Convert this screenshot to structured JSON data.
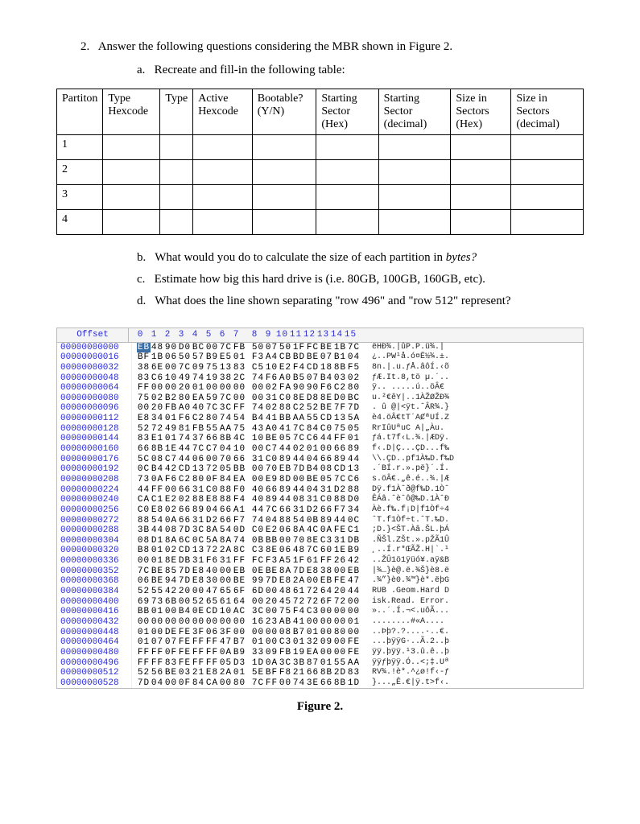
{
  "question_number": "2.",
  "question_text": "Answer the following questions considering the MBR shown in Figure 2.",
  "sub_a_label": "a.",
  "sub_a_text": "Recreate and fill-in the following table:",
  "sub_b_label": "b.",
  "sub_b_text_1": "What would you do to calculate the size of each partition in ",
  "sub_b_text_em": "bytes?",
  "sub_c_label": "c.",
  "sub_c_text": "Estimate how big this hard drive is (i.e. 80GB, 100GB, 160GB, etc).",
  "sub_d_label": "d.",
  "sub_d_text": "What does the line shown separating \"row 496\" and \"row 512\" represent?",
  "table": {
    "headers": [
      "Partiton",
      "Type Hexcode",
      "Type",
      "Active Hexcode",
      "Bootable? (Y/N)",
      "Starting Sector (Hex)",
      "Starting Sector (decimal)",
      "Size in Sectors (Hex)",
      "Size in Sectors (decimal)"
    ],
    "rows": [
      "1",
      "2",
      "3",
      "4"
    ]
  },
  "hex": {
    "offset_label": "Offset",
    "col_nums": [
      "0",
      "1",
      "2",
      "3",
      "4",
      "5",
      "6",
      "7",
      "8",
      "9",
      "10",
      "11",
      "12",
      "13",
      "14",
      "15"
    ],
    "rows": [
      {
        "off": "00000000000",
        "hl0": true,
        "b": [
          "EB",
          "48",
          "90",
          "D0",
          "BC",
          "00",
          "7C",
          "FB",
          "50",
          "07",
          "50",
          "1F",
          "FC",
          "BE",
          "1B",
          "7C"
        ],
        "a": "ëHĐ¾.|ûP.P.ü¾.|"
      },
      {
        "off": "00000000016",
        "b": [
          "BF",
          "1B",
          "06",
          "50",
          "57",
          "B9",
          "E5",
          "01",
          "F3",
          "A4",
          "CB",
          "BD",
          "BE",
          "07",
          "B1",
          "04"
        ],
        "a": "¿..PW¹å.ó¤Ë½¾.±."
      },
      {
        "off": "00000000032",
        "b": [
          "38",
          "6E",
          "00",
          "7C",
          "09",
          "75",
          "13",
          "83",
          "C5",
          "10",
          "E2",
          "F4",
          "CD",
          "18",
          "8B",
          "F5"
        ],
        "a": "8n.|.u.ƒÅ.âôÍ.‹õ"
      },
      {
        "off": "00000000048",
        "b": [
          "83",
          "C6",
          "10",
          "49",
          "74",
          "19",
          "38",
          "2C",
          "74",
          "F6",
          "A0",
          "B5",
          "07",
          "B4",
          "03",
          "02"
        ],
        "a": "ƒÆ.It.8,tö µ.´.."
      },
      {
        "off": "00000000064",
        "b": [
          "FF",
          "00",
          "00",
          "20",
          "01",
          "00",
          "00",
          "00",
          "00",
          "02",
          "FA",
          "90",
          "90",
          "F6",
          "C2",
          "80"
        ],
        "a": "ÿ.. .....ú..öÂ€"
      },
      {
        "off": "00000000080",
        "b": [
          "75",
          "02",
          "B2",
          "80",
          "EA",
          "59",
          "7C",
          "00",
          "00",
          "31",
          "C0",
          "8E",
          "D8",
          "8E",
          "D0",
          "BC"
        ],
        "a": "u.²€êY|..1ÀŽØŽÐ¾"
      },
      {
        "off": "00000000096",
        "b": [
          "00",
          "20",
          "FB",
          "A0",
          "40",
          "7C",
          "3C",
          "FF",
          "74",
          "02",
          "88",
          "C2",
          "52",
          "BE",
          "7F",
          "7D"
        ],
        "a": ". û @|<ÿt.ˆÂR¾.}"
      },
      {
        "off": "00000000112",
        "b": [
          "E8",
          "34",
          "01",
          "F6",
          "C2",
          "80",
          "74",
          "54",
          "B4",
          "41",
          "BB",
          "AA",
          "55",
          "CD",
          "13",
          "5A"
        ],
        "a": "è4.öÂ€tT´AȻªUÍ.Z"
      },
      {
        "off": "00000000128",
        "b": [
          "52",
          "72",
          "49",
          "81",
          "FB",
          "55",
          "AA",
          "75",
          "43",
          "A0",
          "41",
          "7C",
          "84",
          "C0",
          "75",
          "05"
        ],
        "a": "RrIûUªuC A|„Àu."
      },
      {
        "off": "00000000144",
        "b": [
          "83",
          "E1",
          "01",
          "74",
          "37",
          "66",
          "8B",
          "4C",
          "10",
          "BE",
          "05",
          "7C",
          "C6",
          "44",
          "FF",
          "01"
        ],
        "a": "ƒá.t7f‹L.¾.|ÆDÿ."
      },
      {
        "off": "00000000160",
        "b": [
          "66",
          "8B",
          "1E",
          "44",
          "7C",
          "C7",
          "04",
          "10",
          "00",
          "C7",
          "44",
          "02",
          "01",
          "00",
          "66",
          "89"
        ],
        "a": "f‹.D|Ç...ÇD...f‰"
      },
      {
        "off": "00000000176",
        "b": [
          "5C",
          "08",
          "C7",
          "44",
          "06",
          "00",
          "70",
          "66",
          "31",
          "C0",
          "89",
          "44",
          "04",
          "66",
          "89",
          "44"
        ],
        "a": "\\\\.ÇD..pf1À‰D.f‰D"
      },
      {
        "off": "00000000192",
        "b": [
          "0C",
          "B4",
          "42",
          "CD",
          "13",
          "72",
          "05",
          "BB",
          "00",
          "70",
          "EB",
          "7D",
          "B4",
          "08",
          "CD",
          "13"
        ],
        "a": ".´BÍ.r.».pë}´.Í."
      },
      {
        "off": "00000000208",
        "b": [
          "73",
          "0A",
          "F6",
          "C2",
          "80",
          "0F",
          "84",
          "EA",
          "00",
          "E9",
          "8D",
          "00",
          "BE",
          "05",
          "7C",
          "C6"
        ],
        "a": "s.öÂ€.„ê.é..¾.|Æ"
      },
      {
        "off": "00000000224",
        "b": [
          "44",
          "FF",
          "00",
          "66",
          "31",
          "C0",
          "88",
          "F0",
          "40",
          "66",
          "89",
          "44",
          "04",
          "31",
          "D2",
          "88"
        ],
        "a": "Dÿ.f1Àˆð@f‰D.1Òˆ"
      },
      {
        "off": "00000000240",
        "b": [
          "CA",
          "C1",
          "E2",
          "02",
          "88",
          "E8",
          "88",
          "F4",
          "40",
          "89",
          "44",
          "08",
          "31",
          "C0",
          "88",
          "D0"
        ],
        "a": "ÊÁâ.ˆèˆô@‰D.1ÀˆÐ"
      },
      {
        "off": "00000000256",
        "b": [
          "C0",
          "E8",
          "02",
          "66",
          "89",
          "04",
          "66",
          "A1",
          "44",
          "7C",
          "66",
          "31",
          "D2",
          "66",
          "F7",
          "34"
        ],
        "a": "Àè.f‰.f¡D|f1Òf÷4"
      },
      {
        "off": "00000000272",
        "b": [
          "88",
          "54",
          "0A",
          "66",
          "31",
          "D2",
          "66",
          "F7",
          "74",
          "04",
          "88",
          "54",
          "0B",
          "89",
          "44",
          "0C"
        ],
        "a": "ˆT.f1Òf÷t.ˆT.‰D."
      },
      {
        "off": "00000000288",
        "b": [
          "3B",
          "44",
          "08",
          "7D",
          "3C",
          "8A",
          "54",
          "0D",
          "C0",
          "E2",
          "06",
          "8A",
          "4C",
          "0A",
          "FE",
          "C1"
        ],
        "a": ";D.}<ŠT.Àâ.ŠL.þÁ"
      },
      {
        "off": "00000000304",
        "b": [
          "08",
          "D1",
          "8A",
          "6C",
          "0C",
          "5A",
          "8A",
          "74",
          "0B",
          "BB",
          "00",
          "70",
          "8E",
          "C3",
          "31",
          "DB"
        ],
        "a": ".ÑŠl.ZŠt.».pŽÃ1Û"
      },
      {
        "off": "00000000320",
        "b": [
          "B8",
          "01",
          "02",
          "CD",
          "13",
          "72",
          "2A",
          "8C",
          "C3",
          "8E",
          "06",
          "48",
          "7C",
          "60",
          "1E",
          "B9"
        ],
        "a": "¸..Í.r*ŒÃŽ.H|`.¹"
      },
      {
        "off": "00000000336",
        "b": [
          "00",
          "01",
          "8E",
          "DB",
          "31",
          "F6",
          "31",
          "FF",
          "FC",
          "F3",
          "A5",
          "1F",
          "61",
          "FF",
          "26",
          "42"
        ],
        "a": "..ŽÛ1ö1ÿüó¥.aÿ&B"
      },
      {
        "off": "00000000352",
        "b": [
          "7C",
          "BE",
          "85",
          "7D",
          "E8",
          "40",
          "00",
          "EB",
          "0E",
          "BE",
          "8A",
          "7D",
          "E8",
          "38",
          "00",
          "EB"
        ],
        "a": "|¾…}è@.ë.¾Š}è8.ë"
      },
      {
        "off": "00000000368",
        "b": [
          "06",
          "BE",
          "94",
          "7D",
          "E8",
          "30",
          "00",
          "BE",
          "99",
          "7D",
          "E8",
          "2A",
          "00",
          "EB",
          "FE",
          "47"
        ],
        "a": ".¾”}è0.¾™}è*.ëþG"
      },
      {
        "off": "00000000384",
        "b": [
          "52",
          "55",
          "42",
          "20",
          "00",
          "47",
          "65",
          "6F",
          "6D",
          "00",
          "48",
          "61",
          "72",
          "64",
          "20",
          "44"
        ],
        "a": "RUB .Geom.Hard D"
      },
      {
        "off": "00000000400",
        "b": [
          "69",
          "73",
          "6B",
          "00",
          "52",
          "65",
          "61",
          "64",
          "00",
          "20",
          "45",
          "72",
          "72",
          "6F",
          "72",
          "00"
        ],
        "a": "isk.Read. Error."
      },
      {
        "off": "00000000416",
        "b": [
          "BB",
          "01",
          "00",
          "B4",
          "0E",
          "CD",
          "10",
          "AC",
          "3C",
          "00",
          "75",
          "F4",
          "C3",
          "00",
          "00",
          "00"
        ],
        "a": "»..´.Í.¬<.uôÃ..."
      },
      {
        "off": "00000000432",
        "b": [
          "00",
          "00",
          "00",
          "00",
          "00",
          "00",
          "00",
          "00",
          "16",
          "23",
          "AB",
          "41",
          "00",
          "00",
          "00",
          "01"
        ],
        "a": "........#«A...."
      },
      {
        "off": "00000000448",
        "b": [
          "01",
          "00",
          "DE",
          "FE",
          "3F",
          "06",
          "3F",
          "00",
          "00",
          "00",
          "08",
          "B7",
          "01",
          "00",
          "80",
          "00"
        ],
        "a": "..Þþ?.?....·..€."
      },
      {
        "off": "00000000464",
        "b": [
          "01",
          "07",
          "07",
          "FE",
          "FF",
          "FF",
          "47",
          "B7",
          "01",
          "00",
          "C3",
          "01",
          "32",
          "09",
          "00",
          "FE"
        ],
        "a": "...þÿÿG·..Ã.2..þ"
      },
      {
        "off": "00000000480",
        "b": [
          "FF",
          "FF",
          "0F",
          "FE",
          "FF",
          "FF",
          "0A",
          "B9",
          "33",
          "09",
          "FB",
          "19",
          "EA",
          "00",
          "00",
          "FE"
        ],
        "a": "ÿÿ.þÿÿ.¹3.û.ê..þ"
      },
      {
        "off": "00000000496",
        "b": [
          "FF",
          "FF",
          "83",
          "FE",
          "FF",
          "FF",
          "05",
          "D3",
          "1D",
          "0A",
          "3C",
          "3B",
          "87",
          "01",
          "55",
          "AA"
        ],
        "a": "ÿÿƒþÿÿ.Ó..<;‡.Uª"
      },
      {
        "off": "00000000512",
        "b": [
          "52",
          "56",
          "BE",
          "03",
          "21",
          "E8",
          "2A",
          "01",
          "5E",
          "BF",
          "F8",
          "21",
          "66",
          "8B",
          "2D",
          "83"
        ],
        "a": "RV¾.!è*.^¿ø!f‹-ƒ"
      },
      {
        "off": "00000000528",
        "b": [
          "7D",
          "04",
          "00",
          "0F",
          "84",
          "CA",
          "00",
          "80",
          "7C",
          "FF",
          "00",
          "74",
          "3E",
          "66",
          "8B",
          "1D"
        ],
        "a": "}...„Ê.€|ÿ.t>f‹."
      }
    ]
  },
  "figure_caption": "Figure 2."
}
